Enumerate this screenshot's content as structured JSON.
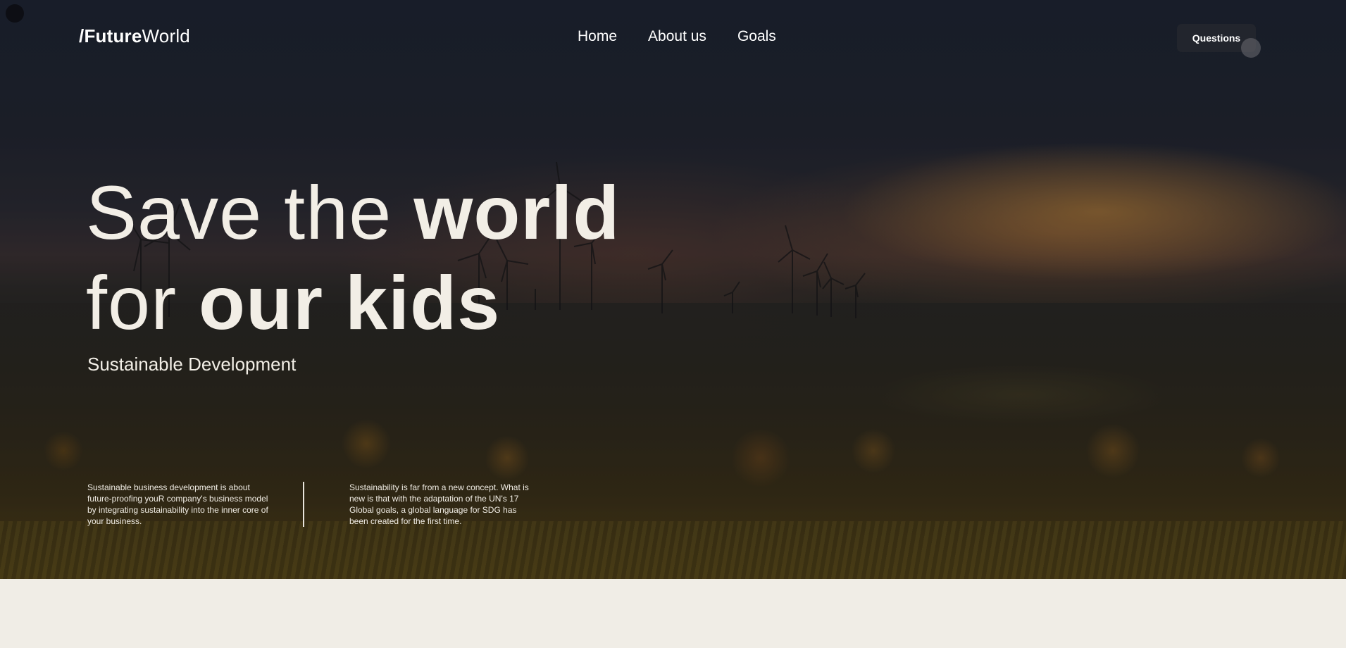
{
  "nav": {
    "logo_slash": "/",
    "logo_bold": "Future",
    "logo_light": "World",
    "links": [
      {
        "label": "Home"
      },
      {
        "label": "About us"
      },
      {
        "label": "Goals"
      }
    ],
    "cta_label": "Questions"
  },
  "hero": {
    "headline_line1_thin": "Save the ",
    "headline_line1_bold": "world",
    "headline_line2_thin": "for ",
    "headline_line2_bold": "our kids",
    "subtitle": "Sustainable Development",
    "blurb_left": "Sustainable business development is about future-proofing youR company's business model by integrating sustainability into the inner core of your business.",
    "blurb_right": "Sustainability is far from a new concept. What is new is that with the adaptation of the UN's 17 Global goals, a global language for SDG has been created for the first time."
  },
  "colors": {
    "text_light": "#f2eee6",
    "button_bg": "#22252d",
    "page_bg": "#f0ede6"
  }
}
